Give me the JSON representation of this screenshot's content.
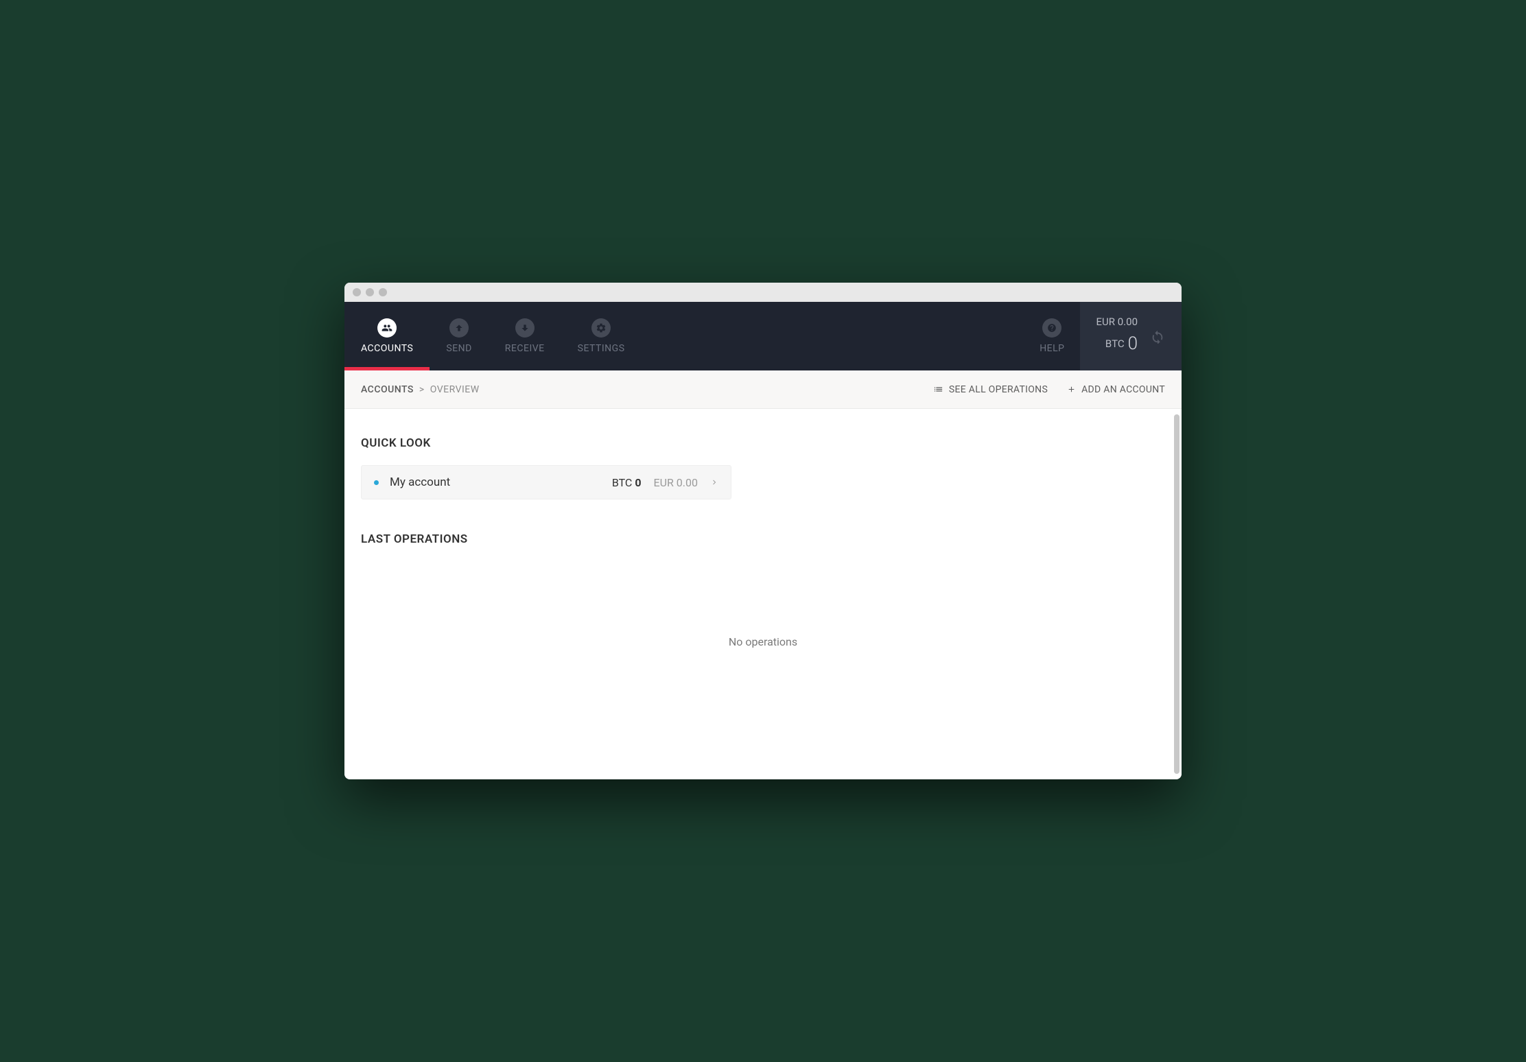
{
  "nav": {
    "accounts": "ACCOUNTS",
    "send": "SEND",
    "receive": "RECEIVE",
    "settings": "SETTINGS",
    "help": "HELP"
  },
  "balance": {
    "eur_label": "EUR",
    "eur_value": "0.00",
    "btc_label": "BTC",
    "btc_value": "0"
  },
  "breadcrumb": {
    "root": "ACCOUNTS",
    "sep": ">",
    "current": "OVERVIEW"
  },
  "actions": {
    "see_all": "SEE ALL OPERATIONS",
    "add_account": "ADD AN ACCOUNT"
  },
  "sections": {
    "quick_look": "QUICK LOOK",
    "last_operations": "LAST OPERATIONS"
  },
  "account": {
    "name": "My account",
    "btc_label": "BTC",
    "btc_value": "0",
    "eur_label": "EUR",
    "eur_value": "0.00"
  },
  "empty": {
    "no_operations": "No operations"
  }
}
